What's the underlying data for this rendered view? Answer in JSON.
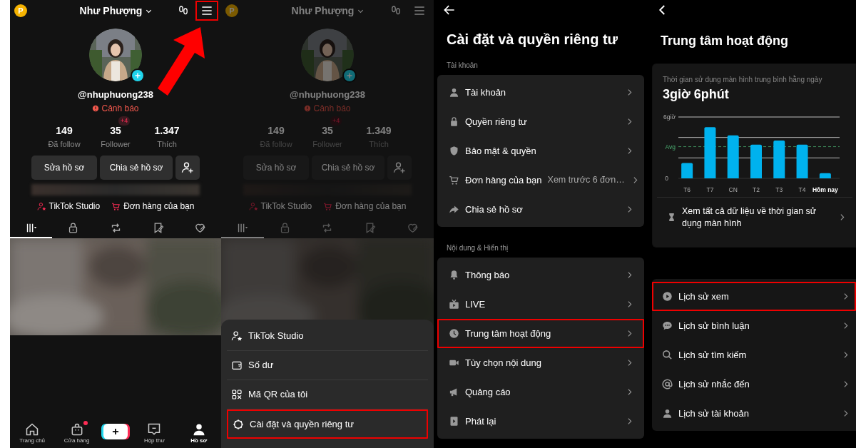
{
  "screens": [
    {
      "kind": "profile",
      "dimmed": false,
      "coin": "P",
      "username": "Như Phượng",
      "menu_highlighted": true,
      "handle": "@nhuphuong238",
      "warning": "Cảnh báo",
      "stats": [
        {
          "value": "149",
          "label": "Đã follow"
        },
        {
          "value": "35",
          "label": "Follower",
          "badge": "+4"
        },
        {
          "value": "1.347",
          "label": "Thích"
        }
      ],
      "buttons": [
        "Sửa hồ sơ",
        "Chia sẻ hồ sơ"
      ],
      "links": [
        "TikTok Studio",
        "Đơn hàng của bạn"
      ],
      "tabs": [
        {
          "selected": true
        },
        {
          "selected": false
        },
        {
          "selected": false
        },
        {
          "selected": false
        },
        {
          "selected": false
        }
      ],
      "nav": [
        {
          "kind": "tab",
          "label": "Trang chủ",
          "selected": false,
          "dot": false
        },
        {
          "kind": "tab",
          "label": "Cửa hàng",
          "selected": false,
          "dot": true
        },
        {
          "kind": "create"
        },
        {
          "kind": "tab",
          "label": "Hộp thư",
          "selected": false,
          "dot": false
        },
        {
          "kind": "tab",
          "label": "Hồ sơ",
          "selected": true,
          "dot": false
        }
      ]
    },
    {
      "kind": "profile",
      "dimmed": true,
      "coin": "P",
      "username": "Như Phượng",
      "menu_highlighted": false,
      "handle": "@nhuphuong238",
      "warning": "Cảnh báo",
      "stats": [
        {
          "value": "149",
          "label": "Đã follow"
        },
        {
          "value": "35",
          "label": "Follower",
          "badge": "+4"
        },
        {
          "value": "1.349",
          "label": "Thích"
        }
      ],
      "buttons": [
        "Sửa hồ sơ",
        "Chia sẻ hồ sơ"
      ],
      "links": [
        "TikTok Studio",
        "Đơn hàng của bạn"
      ],
      "tabs": [
        {
          "selected": true
        },
        {
          "selected": false
        },
        {
          "selected": false
        },
        {
          "selected": false
        },
        {
          "selected": false
        }
      ],
      "sheet": [
        {
          "label": "TikTok Studio",
          "highlighted": false
        },
        {
          "label": "Số dư",
          "highlighted": false
        },
        {
          "label": "Mã QR của tôi",
          "highlighted": false
        },
        {
          "label": "Cài đặt và quyền riêng tư",
          "highlighted": true
        }
      ]
    },
    {
      "kind": "settings",
      "title": "Cài đặt và quyền riêng tư",
      "sections": [
        {
          "heading": "Tài khoản",
          "items": [
            {
              "label": "Tài khoản",
              "highlighted": false
            },
            {
              "label": "Quyền riêng tư",
              "highlighted": false
            },
            {
              "label": "Bảo mật & quyền",
              "highlighted": false
            },
            {
              "label": "Đơn hàng của bạn",
              "value": "Xem trước 6 đơn…",
              "highlighted": false
            },
            {
              "label": "Chia sẻ hồ sơ",
              "highlighted": false
            }
          ]
        },
        {
          "heading": "Nội dung & Hiển thị",
          "items": [
            {
              "label": "Thông báo",
              "highlighted": false
            },
            {
              "label": "LIVE",
              "highlighted": false
            },
            {
              "label": "Trung tâm hoạt động",
              "highlighted": true
            },
            {
              "label": "Tùy chọn nội dung",
              "highlighted": false
            },
            {
              "label": "Quảng cáo",
              "highlighted": false
            },
            {
              "label": "Phát lại",
              "highlighted": false
            }
          ]
        }
      ]
    },
    {
      "kind": "activity",
      "title": "Trung tâm hoạt động",
      "subtitle": "Thời gian sử dụng màn hình trung bình hằng ngày",
      "total": "3giờ 6phút",
      "chart": {
        "top_label": "6giờ",
        "avg_label": "Avg",
        "zero_label": "0",
        "days": [
          "T6",
          "T7",
          "CN",
          "T2",
          "T3",
          "T4",
          "Hôm nay"
        ]
      },
      "see_all": "Xem tất cả dữ liệu về thời gian sử dụng màn hình",
      "items": [
        {
          "label": "Lịch sử xem",
          "highlighted": true
        },
        {
          "label": "Lịch sử bình luận",
          "highlighted": false
        },
        {
          "label": "Lịch sử tìm kiếm",
          "highlighted": false
        },
        {
          "label": "Lịch sử nhắc đến",
          "highlighted": false
        },
        {
          "label": "Lịch sử tài khoản",
          "highlighted": false
        }
      ]
    }
  ]
}
